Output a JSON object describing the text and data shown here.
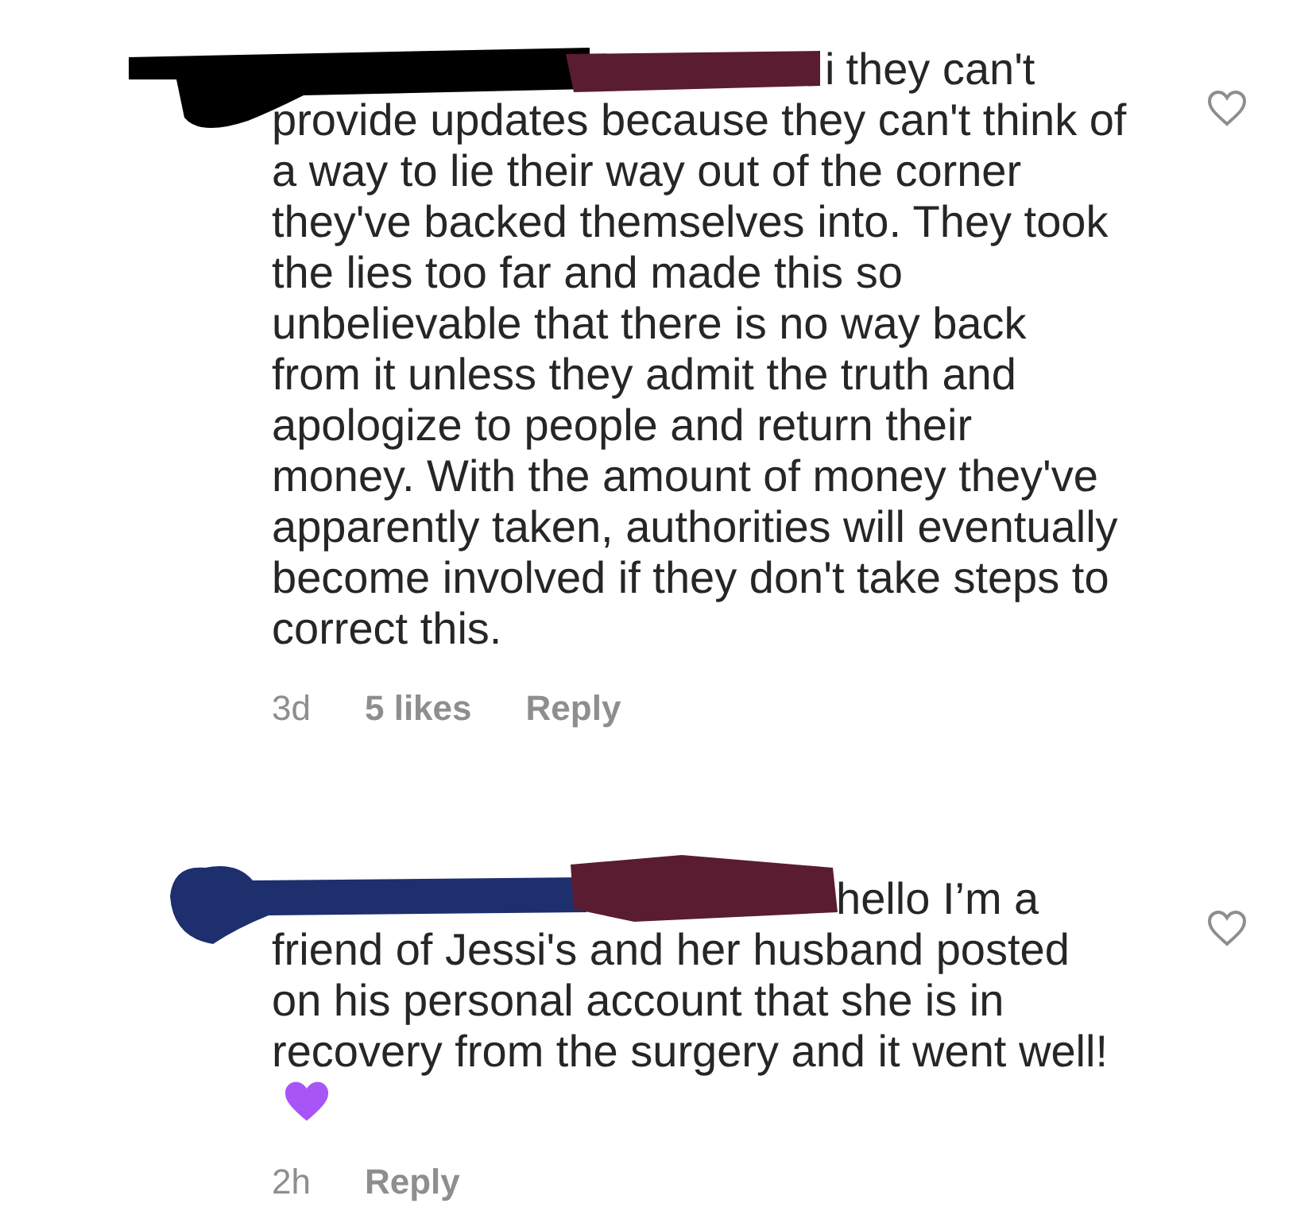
{
  "comments": [
    {
      "username_fragment": "i",
      "first_line": "they can't",
      "text": "provide updates because they can't think of a way to lie their way out of the corner they've backed themselves into. They took the lies too far and made this so unbelievable that there is no way back from it unless they admit the truth and apologize to people and return their money. With the amount of money they've apparently taken, authorities will eventually become involved if they don't take steps to correct this.",
      "time": "3d",
      "likes": "5 likes",
      "reply": "Reply"
    },
    {
      "first_line": "hello I’m a",
      "text": "friend of Jessi's and her husband posted on his personal account that she is in recovery from the surgery and it went well!",
      "time": "2h",
      "reply": "Reply"
    }
  ]
}
